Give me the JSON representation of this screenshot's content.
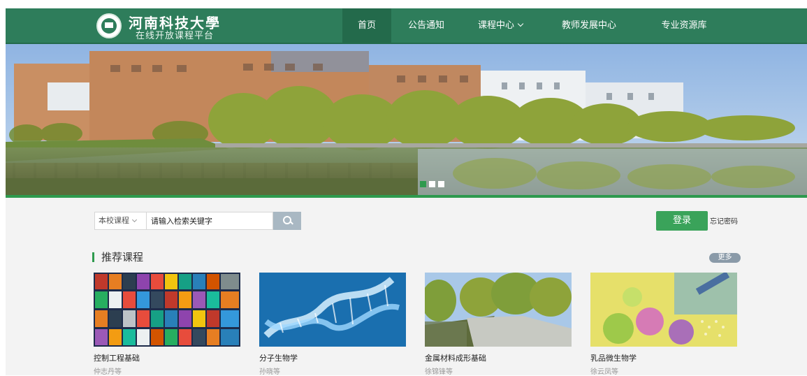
{
  "header": {
    "title": "河南科技大學",
    "subtitle": "在线开放课程平台",
    "nav": [
      {
        "label": "首页"
      },
      {
        "label": "公告通知"
      },
      {
        "label": "课程中心"
      },
      {
        "label": "教师发展中心"
      },
      {
        "label": "专业资源库"
      }
    ]
  },
  "banner": {
    "slide_count": 3,
    "active_slide": 1
  },
  "search": {
    "scope": "本校课程",
    "placeholder": "请输入检索关键字"
  },
  "auth": {
    "login_label": "登录",
    "forgot_label": "忘记密码"
  },
  "recommended": {
    "title": "推荐课程",
    "more_label": "更多",
    "courses": [
      {
        "name": "控制工程基础",
        "teacher": "仲志丹等"
      },
      {
        "name": "分子生物学",
        "teacher": "孙晓等"
      },
      {
        "name": "金属材料成形基础",
        "teacher": "徐锦锋等"
      },
      {
        "name": "乳品微生物学",
        "teacher": "徐云凤等"
      }
    ]
  },
  "colors": {
    "brand_green": "#2e7d5b",
    "button_green": "#3aa35a"
  }
}
